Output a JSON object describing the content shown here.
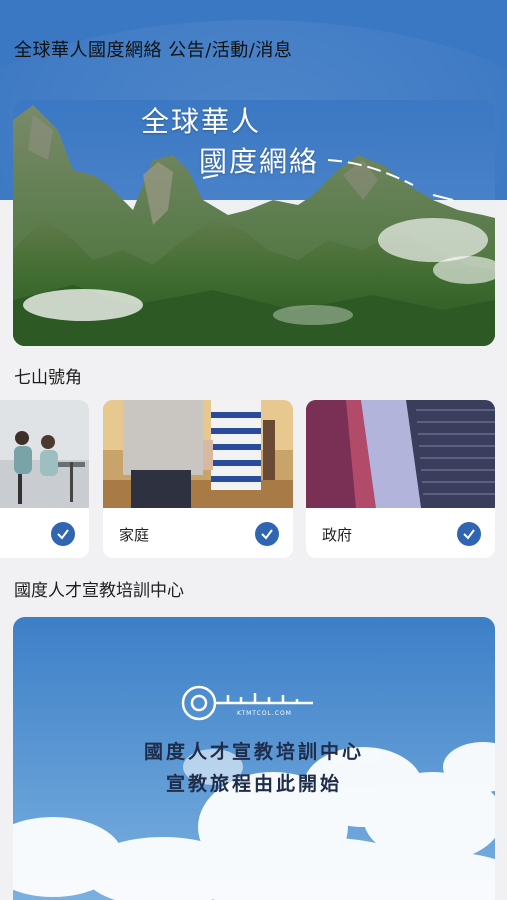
{
  "header": {
    "title": "全球華人國度網絡 公告/活動/消息"
  },
  "banner": {
    "line1": "全球華人",
    "line2": "國度網絡"
  },
  "section_seven": {
    "title": "七山號角",
    "cards": [
      {
        "label": ""
      },
      {
        "label": "家庭"
      },
      {
        "label": "政府"
      }
    ]
  },
  "section_training": {
    "title": "國度人才宣教培訓中心",
    "logo_text": "KTMTCOL.COM",
    "line1": "國度人才宣教培訓中心",
    "line2": "宣教旅程由此開始"
  },
  "colors": {
    "accent": "#3b78c3",
    "check": "#2f65b3",
    "background": "#f1f1f3"
  }
}
